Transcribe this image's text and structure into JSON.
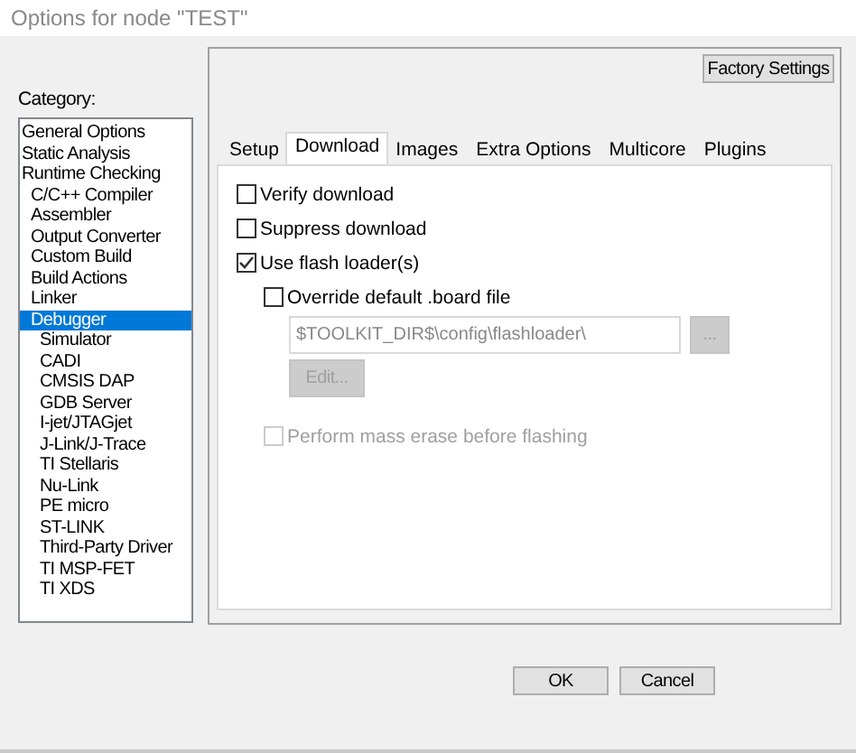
{
  "window": {
    "title": "Options for node \"TEST\""
  },
  "category": {
    "label": "Category:",
    "items": [
      {
        "label": "General Options",
        "selected": false
      },
      {
        "label": "Static Analysis",
        "selected": false
      },
      {
        "label": "Runtime Checking",
        "selected": false,
        "children": [
          {
            "label": "C/C++ Compiler",
            "selected": false
          },
          {
            "label": "Assembler",
            "selected": false
          },
          {
            "label": "Output Converter",
            "selected": false
          },
          {
            "label": "Custom Build",
            "selected": false
          },
          {
            "label": "Build Actions",
            "selected": false
          },
          {
            "label": "Linker",
            "selected": false
          },
          {
            "label": "Debugger",
            "selected": true,
            "children": [
              {
                "label": "Simulator",
                "selected": false
              },
              {
                "label": "CADI",
                "selected": false
              },
              {
                "label": "CMSIS DAP",
                "selected": false
              },
              {
                "label": "GDB Server",
                "selected": false
              },
              {
                "label": "I-jet/JTAGjet",
                "selected": false
              },
              {
                "label": "J-Link/J-Trace",
                "selected": false
              },
              {
                "label": "TI Stellaris",
                "selected": false
              },
              {
                "label": "Nu-Link",
                "selected": false
              },
              {
                "label": "PE micro",
                "selected": false
              },
              {
                "label": "ST-LINK",
                "selected": false
              },
              {
                "label": "Third-Party Driver",
                "selected": false
              },
              {
                "label": "TI MSP-FET",
                "selected": false
              },
              {
                "label": "TI XDS",
                "selected": false
              }
            ]
          }
        ]
      }
    ]
  },
  "factory_settings_button": "Factory Settings",
  "tabs": [
    {
      "label": "Setup",
      "selected": false
    },
    {
      "label": "Download",
      "selected": true
    },
    {
      "label": "Images",
      "selected": false
    },
    {
      "label": "Extra Options",
      "selected": false
    },
    {
      "label": "Multicore",
      "selected": false
    },
    {
      "label": "Plugins",
      "selected": false
    }
  ],
  "options": [
    {
      "kind": "checkbox",
      "label": "Verify download",
      "checked": false,
      "disabled": false
    },
    {
      "kind": "checkbox",
      "label": "Suppress download",
      "checked": false,
      "disabled": false
    },
    {
      "kind": "checkbox",
      "label": "Use flash loader(s)",
      "checked": true,
      "disabled": false
    },
    {
      "kind": "checkbox",
      "label": "Override default .board file",
      "checked": false,
      "disabled": false,
      "indent": true
    },
    {
      "kind": "path",
      "value": "$TOOLKIT_DIR$\\config\\flashloader\\",
      "browse": "...",
      "disabled": true
    },
    {
      "kind": "button",
      "label": "Edit...",
      "disabled": true
    },
    {
      "kind": "checkbox",
      "label": "Perform mass erase before flashing",
      "checked": false,
      "disabled": true,
      "indent": true
    }
  ],
  "buttons": [
    "OK",
    "Cancel"
  ]
}
